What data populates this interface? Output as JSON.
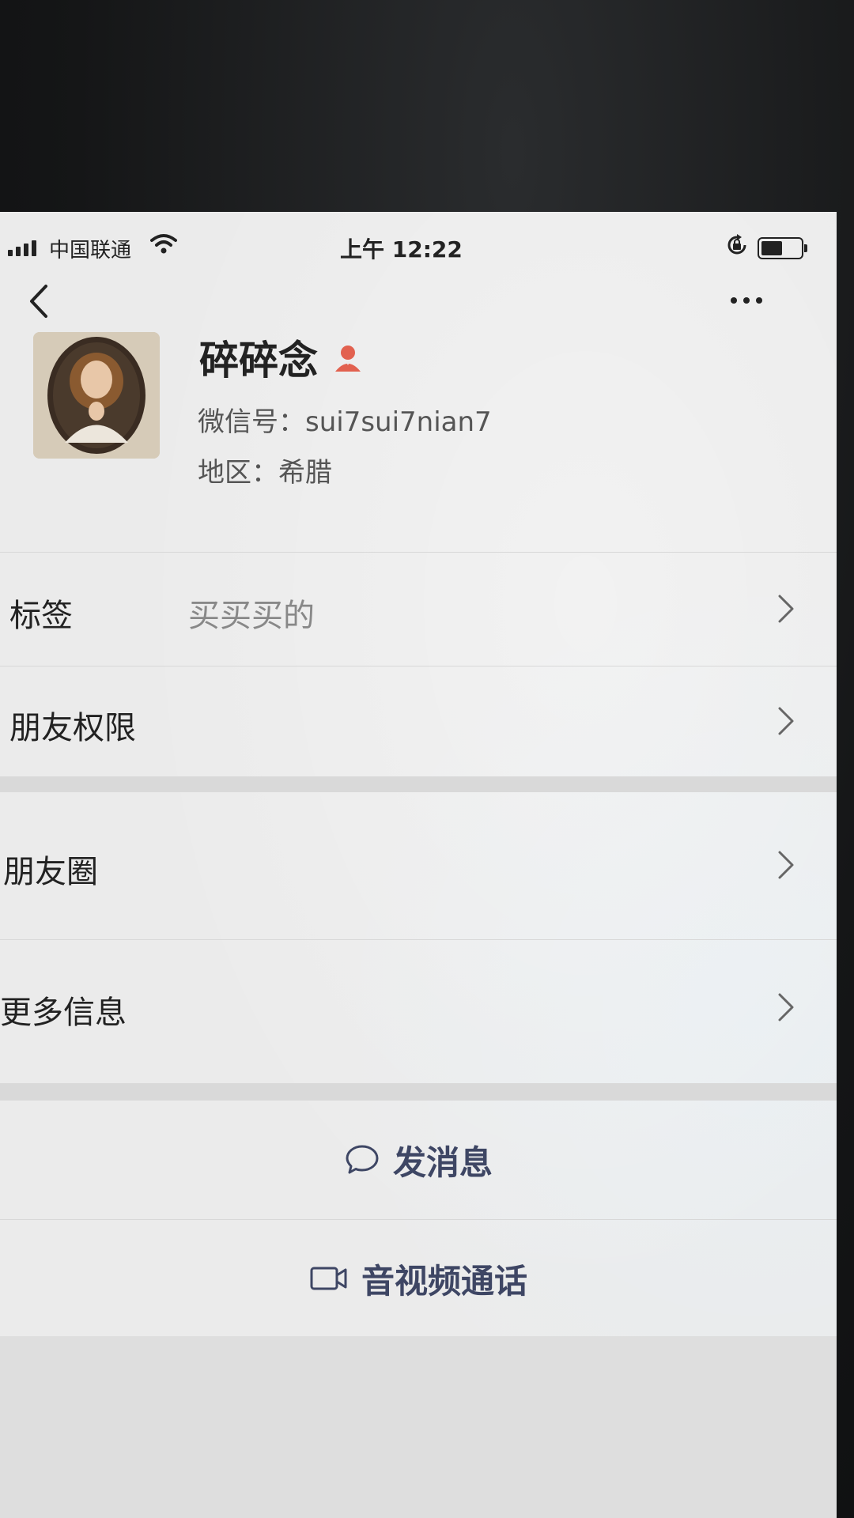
{
  "status_bar": {
    "carrier": "中国联通",
    "time": "上午 12:22"
  },
  "nav": {
    "back_icon": "chevron-left-icon",
    "more_icon": "ellipsis-icon"
  },
  "profile": {
    "name": "碎碎念",
    "wechat_id": "微信号：sui7sui7nian7",
    "region": "地区：希腊",
    "badge_color": "#e2614f"
  },
  "rows": {
    "tags": {
      "label": "标签",
      "value": "买买买的"
    },
    "permissions": {
      "label": "朋友权限"
    },
    "moments": {
      "label": "朋友圈"
    },
    "more_info": {
      "label": "更多信息"
    }
  },
  "actions": {
    "message": {
      "label": "发消息",
      "icon": "chat-bubble-icon"
    },
    "call": {
      "label": "音视频通话",
      "icon": "video-camera-icon"
    }
  },
  "colors": {
    "action_text": "#3e4664",
    "background": "#ebebeb"
  }
}
